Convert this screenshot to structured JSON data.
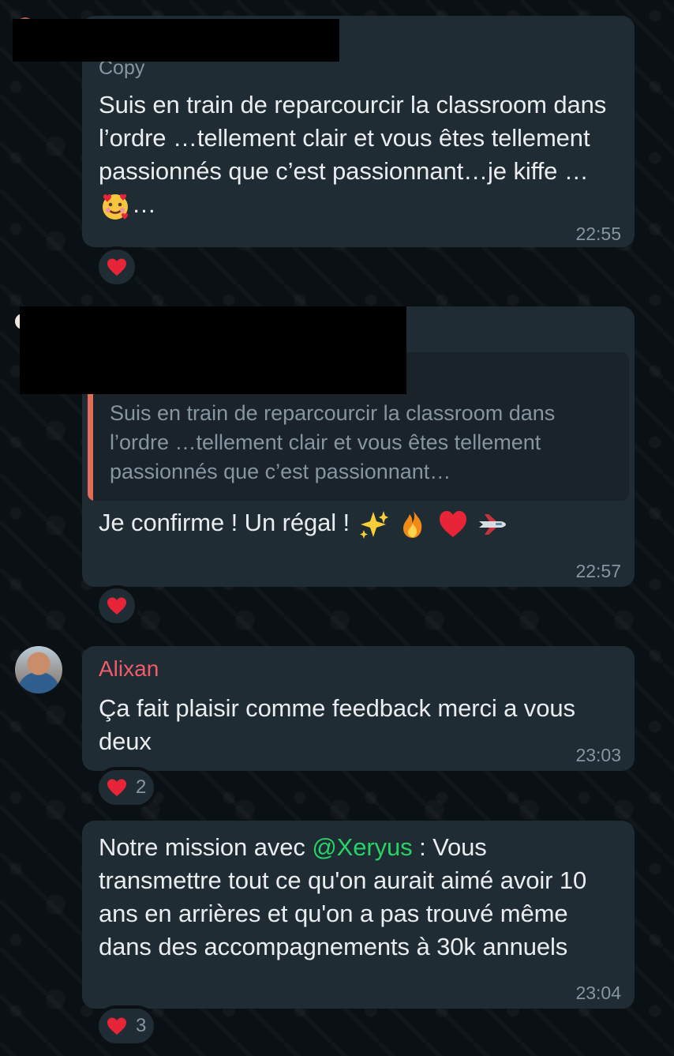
{
  "messages": [
    {
      "copy_label": "Copy",
      "text_before_emoji": "Suis en train de reparcourcir la classroom dans l’ordre …tellement clair et vous êtes tellement passionnés que c’est passionnant…je kiffe …",
      "text_after_emoji": "…",
      "emoji": "smiling-face-with-hearts-icon",
      "time": "22:55",
      "reaction": {
        "icon": "heart-icon",
        "count": ""
      }
    },
    {
      "quoted_text": "Suis en train de reparcourcir la classroom dans l’ordre …tellement clair et vous êtes tellement passionnés que c’est passionnant…",
      "text": "Je confirme ! Un régal ! ",
      "emojis": [
        "sparkles-icon",
        "fire-icon",
        "heart-icon",
        "airplane-icon"
      ],
      "time": "22:57",
      "reaction": {
        "icon": "heart-icon",
        "count": ""
      }
    },
    {
      "sender": "Alixan",
      "text": "Ça fait plaisir comme feedback merci a vous deux",
      "time": "23:03",
      "reaction": {
        "icon": "heart-icon",
        "count": "2"
      }
    },
    {
      "text_prefix": "Notre mission avec ",
      "mention": "@Xeryus",
      "text_suffix": " : Vous transmettre tout ce qu'on aurait aimé avoir 10 ans en arrières et qu'on a pas trouvé même dans des accompagnements à 30k annuels",
      "time": "23:04",
      "reaction": {
        "icon": "heart-icon",
        "count": "3"
      }
    }
  ],
  "colors": {
    "background": "#0b1014",
    "bubble": "#202c33",
    "text": "#e9edef",
    "meta": "#8696a0",
    "sender": "#f15c6d",
    "mention": "#25d366",
    "quote_bar": "#e26d56",
    "heart": "#e82438"
  }
}
